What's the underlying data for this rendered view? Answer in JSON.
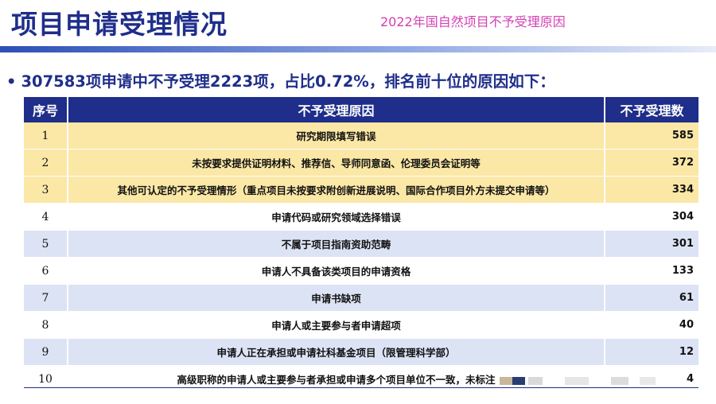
{
  "page": {
    "title": "项目申请受理情况",
    "subtitle": "2022年国自然项目不予受理原因"
  },
  "headline": {
    "bullet": "•",
    "text": "307583项申请中不予受理2223项，占比0.72%，排名前十位的原因如下："
  },
  "table": {
    "headers": [
      "序号",
      "不予受理原因",
      "不予受理数"
    ],
    "rows": [
      {
        "no": "1",
        "reason": "研究期限填写错误",
        "count": "585",
        "style": "hl"
      },
      {
        "no": "2",
        "reason": "未按要求提供证明材料、推荐信、导师同意函、伦理委员会证明等",
        "count": "372",
        "style": "hl"
      },
      {
        "no": "3",
        "reason": "其他可认定的不予受理情形（重点项目未按要求附创新进展说明、国际合作项目外方未提交申请等）",
        "count": "334",
        "style": "hl"
      },
      {
        "no": "4",
        "reason": "申请代码或研究领域选择错误",
        "count": "304",
        "style": "plain"
      },
      {
        "no": "5",
        "reason": "不属于项目指南资助范畴",
        "count": "301",
        "style": "alt"
      },
      {
        "no": "6",
        "reason": "申请人不具备该类项目的申请资格",
        "count": "133",
        "style": "plain"
      },
      {
        "no": "7",
        "reason": "申请书缺项",
        "count": "61",
        "style": "alt"
      },
      {
        "no": "8",
        "reason": "申请人或主要参与者申请超项",
        "count": "40",
        "style": "plain"
      },
      {
        "no": "9",
        "reason": "申请人正在承担或申请社科基金项目（限管理科学部）",
        "count": "12",
        "style": "alt"
      },
      {
        "no": "10",
        "reason": "高级职称的申请人或主要参与者承担或申请多个项目单位不一致，未标注",
        "count": "4",
        "style": "plain"
      }
    ]
  },
  "colors": {
    "primary": "#1f2e8a",
    "subtitle": "#d43fb3",
    "highlight_row": "#fbe8a6",
    "alt_row": "#dce3f4"
  }
}
